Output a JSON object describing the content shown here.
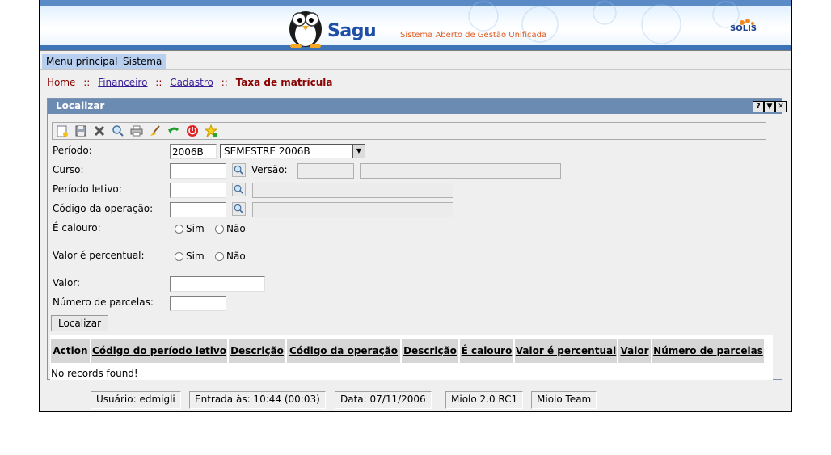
{
  "header": {
    "logo_text": "Sagu",
    "tagline": "Sistema Aberto de Gestão Unificada",
    "partner": "SOLIS"
  },
  "menubar": {
    "items": [
      "Menu principal",
      "Sistema"
    ]
  },
  "breadcrumb": {
    "home": "Home",
    "sep": "::",
    "level1": "Financeiro",
    "level2": "Cadastro",
    "current": "Taxa de matrícula"
  },
  "panel": {
    "title": "Localizar",
    "help_btn": "?",
    "min_btn": "▼",
    "close_btn": "✕",
    "toolbar_icons": [
      "new-icon",
      "save-icon",
      "delete-icon",
      "search-icon",
      "print-icon",
      "clear-icon",
      "back-icon",
      "exit-icon",
      "favorite-icon"
    ]
  },
  "form": {
    "periodo_label": "Período:",
    "periodo_value": "2006B",
    "periodo_select": "SEMESTRE 2006B",
    "curso_label": "Curso:",
    "versao_label": "Versão:",
    "periodo_letivo_label": "Período letivo:",
    "codigo_operacao_label": "Código da operação:",
    "calouro_label": "É calouro:",
    "sim": "Sim",
    "nao": "Não",
    "valor_percentual_label": "Valor é percentual:",
    "valor_label": "Valor:",
    "numero_parcelas_label": "Número de parcelas:",
    "localizar_button": "Localizar"
  },
  "grid": {
    "columns": [
      "Action",
      "Código do período letivo",
      "Descrição",
      "Código da operação",
      "Descrição",
      "É calouro",
      "Valor é percentual",
      "Valor",
      "Número de parcelas"
    ],
    "empty_message": "No records found!"
  },
  "statusbar": {
    "user": "Usuário: edmigli",
    "login_time": "Entrada às: 10:44 (00:03)",
    "date": "Data: 07/11/2006",
    "version": "Miolo 2.0 RC1",
    "team": "Miolo Team"
  },
  "colors": {
    "panel_title_bg": "#6b8bb3",
    "menu_item_bg": "#b9cff0",
    "breadcrumb_current": "#8a0000",
    "grid_header_bg": "#d6d6d6"
  }
}
